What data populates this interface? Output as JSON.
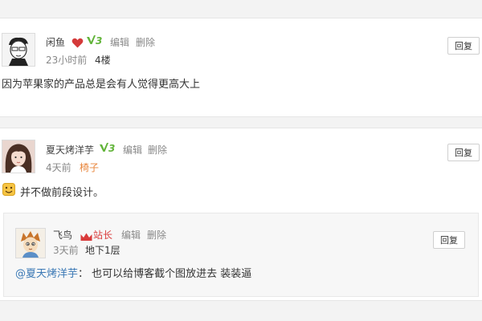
{
  "comments": [
    {
      "user": "闲鱼",
      "vip": "3",
      "edit": "编辑",
      "delete": "删除",
      "time": "23小时前",
      "floor": "4楼",
      "content": "因为苹果家的产品总是会有人觉得更高大上",
      "reply": "回复"
    },
    {
      "user": "夏天烤洋芋",
      "vip": "3",
      "edit": "编辑",
      "delete": "删除",
      "time": "4天前",
      "floor": "椅子",
      "content": "并不做前段设计。",
      "reply": "回复"
    }
  ],
  "nested_reply": {
    "user": "飞鸟",
    "role": "站长",
    "edit": "编辑",
    "delete": "删除",
    "time": "3天前",
    "floor": "地下1层",
    "mention": "@夏天烤洋芋",
    "content": "： 也可以给博客截个图放进去 装装逼",
    "reply": "回复"
  },
  "colors": {
    "heart": "#d43a3a",
    "vip": "#62b43a",
    "mention": "#3a78b5",
    "role": "#d93b3b",
    "floor_highlight": "#e8843a"
  }
}
